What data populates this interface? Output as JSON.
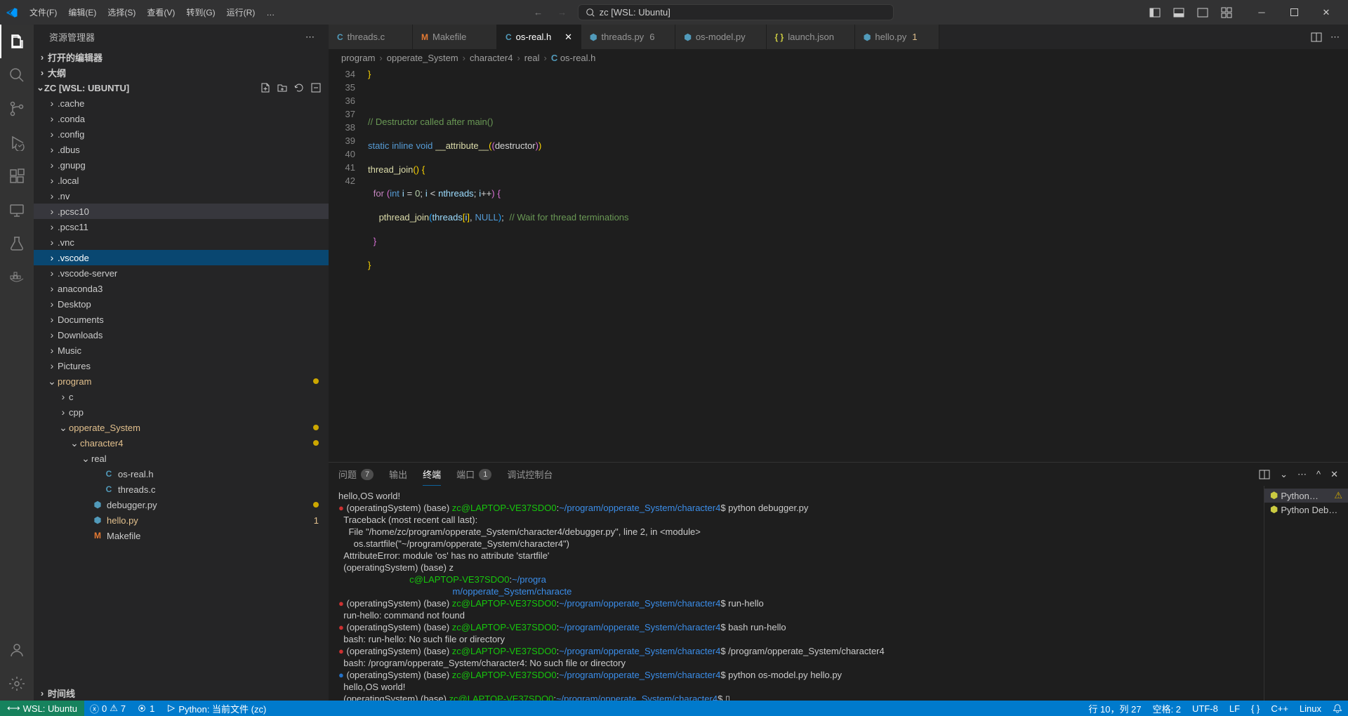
{
  "menu": {
    "file": "文件(F)",
    "edit": "编辑(E)",
    "select": "选择(S)",
    "view": "查看(V)",
    "goto": "转到(G)",
    "run": "运行(R)",
    "more": "…"
  },
  "search": {
    "text": "zc [WSL: Ubuntu]"
  },
  "explorer": {
    "title": "资源管理器",
    "open_editors": "打开的编辑器",
    "outline": "大纲",
    "timeline": "时间线",
    "workspace": "ZC [WSL: UBUNTU]"
  },
  "tree": [
    {
      "name": ".cache",
      "pad": 18
    },
    {
      "name": ".conda",
      "pad": 18
    },
    {
      "name": ".config",
      "pad": 18
    },
    {
      "name": ".dbus",
      "pad": 18
    },
    {
      "name": ".gnupg",
      "pad": 18
    },
    {
      "name": ".local",
      "pad": 18
    },
    {
      "name": ".nv",
      "pad": 18
    },
    {
      "name": ".pcsc10",
      "pad": 18,
      "hl": true
    },
    {
      "name": ".pcsc11",
      "pad": 18
    },
    {
      "name": ".vnc",
      "pad": 18
    },
    {
      "name": ".vscode",
      "pad": 18,
      "selected": true
    },
    {
      "name": ".vscode-server",
      "pad": 18
    },
    {
      "name": "anaconda3",
      "pad": 18
    },
    {
      "name": "Desktop",
      "pad": 18
    },
    {
      "name": "Documents",
      "pad": 18
    },
    {
      "name": "Downloads",
      "pad": 18
    },
    {
      "name": "Music",
      "pad": 18
    },
    {
      "name": "Pictures",
      "pad": 18
    },
    {
      "name": "program",
      "pad": 18,
      "open": true,
      "dot": "#cca700",
      "color": "#e2c08d"
    },
    {
      "name": "c",
      "pad": 34
    },
    {
      "name": "cpp",
      "pad": 34
    },
    {
      "name": "opperate_System",
      "pad": 34,
      "open": true,
      "dot": "#cca700",
      "color": "#e2c08d"
    },
    {
      "name": "character4",
      "pad": 50,
      "open": true,
      "dot": "#cca700",
      "color": "#e2c08d"
    },
    {
      "name": "real",
      "pad": 66,
      "open": true
    },
    {
      "name": "os-real.h",
      "pad": 82,
      "file": "C",
      "iconColor": "#519aba"
    },
    {
      "name": "threads.c",
      "pad": 82,
      "file": "C",
      "iconColor": "#519aba"
    },
    {
      "name": "debugger.py",
      "pad": 66,
      "file": "py",
      "iconColor": "#519aba",
      "dot": "#cca700"
    },
    {
      "name": "hello.py",
      "pad": 66,
      "file": "py",
      "iconColor": "#519aba",
      "color": "#e2c08d",
      "badge": "1"
    },
    {
      "name": "Makefile",
      "pad": 66,
      "file": "M",
      "iconColor": "#e37933"
    }
  ],
  "tabs": [
    {
      "label": "threads.c",
      "icon": "C",
      "iconColor": "#519aba"
    },
    {
      "label": "Makefile",
      "icon": "M",
      "iconColor": "#e37933"
    },
    {
      "label": "os-real.h",
      "icon": "C",
      "iconColor": "#519aba",
      "active": true
    },
    {
      "label": "threads.py",
      "icon": "py",
      "iconColor": "#519aba",
      "badge": "6"
    },
    {
      "label": "os-model.py",
      "icon": "py",
      "iconColor": "#519aba"
    },
    {
      "label": "launch.json",
      "icon": "{}",
      "iconColor": "#cbcb41"
    },
    {
      "label": "hello.py",
      "icon": "py",
      "iconColor": "#519aba",
      "badge": "1",
      "badgeColor": "#e2c08d"
    }
  ],
  "breadcrumb": [
    "program",
    "opperate_System",
    "character4",
    "real",
    "os-real.h"
  ],
  "lines": [
    34,
    35,
    36,
    37,
    38,
    39,
    40,
    41,
    42
  ],
  "paneltabs": {
    "problems": "问题",
    "problems_count": "7",
    "output": "输出",
    "terminal": "终端",
    "ports": "端口",
    "ports_count": "1",
    "debug": "调试控制台"
  },
  "terminal_items": [
    {
      "name": "Python…",
      "warn": true
    },
    {
      "name": "Python Deb…"
    }
  ],
  "status": {
    "remote": "WSL: Ubuntu",
    "errors": "0",
    "warnings": "7",
    "ports": "1",
    "python": "Python: 当前文件 (zc)",
    "line": "行 10，列 27",
    "spaces": "空格: 2",
    "encoding": "UTF-8",
    "eol": "LF",
    "braces": "{ }",
    "lang": "C++",
    "os": "Linux"
  }
}
